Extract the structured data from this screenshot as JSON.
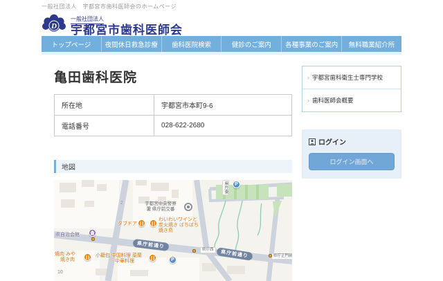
{
  "meta": {
    "tagline": "一般社団法人　宇都宮市歯科医師会のホームページ"
  },
  "header": {
    "org_type": "一般社団法人",
    "site_name": "宇都宮市歯科医師会",
    "logo_letter": "D"
  },
  "nav": {
    "items": [
      {
        "label": "トップページ"
      },
      {
        "label": "夜間休日救急診療"
      },
      {
        "label": "歯科医院検索"
      },
      {
        "label": "健診のご案内"
      },
      {
        "label": "各種事業のご案内"
      },
      {
        "label": "無料職業紹介所"
      }
    ]
  },
  "main": {
    "clinic_name": "亀田歯科医院",
    "info_table": {
      "rows": [
        {
          "label": "所在地",
          "value": "宇都宮市本町9-6"
        },
        {
          "label": "電話番号",
          "value": "028-622-2680"
        }
      ]
    },
    "map_section_title": "地図"
  },
  "sidebar": {
    "links": [
      {
        "label": "宇都宮歯科衛生士専門学校"
      },
      {
        "label": "歯科医師会概要"
      }
    ],
    "login": {
      "title": "ログイン",
      "button": "ログイン画面へ"
    }
  },
  "map": {
    "num2": "2",
    "num10": "10",
    "police": {
      "line1": "宇都宮中央警察",
      "line2": "署 県庁前交番"
    },
    "civic": {
      "label": "県自治会館"
    },
    "tabudoa": {
      "label": "タブドア"
    },
    "waiwai": {
      "line1": "わいわいワインと",
      "line2": "炭火焼き ばちばち",
      "line3": "焼き鳥"
    },
    "yakiniku": {
      "line1": "焼肉 みや",
      "line2": "焼き肉"
    },
    "chinese": {
      "line1": "小籠包 中国料理 菜蘭",
      "line2": "中華料理"
    },
    "parking_letter": "P",
    "banner1": "県庁前通り",
    "banner2": "県庁前通り",
    "vertical_road": "県庁東通り",
    "kencho_nishi": "県庁西",
    "seimon": "県庁正門前"
  },
  "colors": {
    "brand_navy": "#2d3a8c",
    "nav_blue": "#73afdc",
    "accent_blue": "#79aedb",
    "login_button": "#71a7d7",
    "map_orange": "#ef8300",
    "map_purple": "#8e63b5",
    "map_parking_blue": "#548fd6",
    "park_green": "#c6e3bb"
  }
}
